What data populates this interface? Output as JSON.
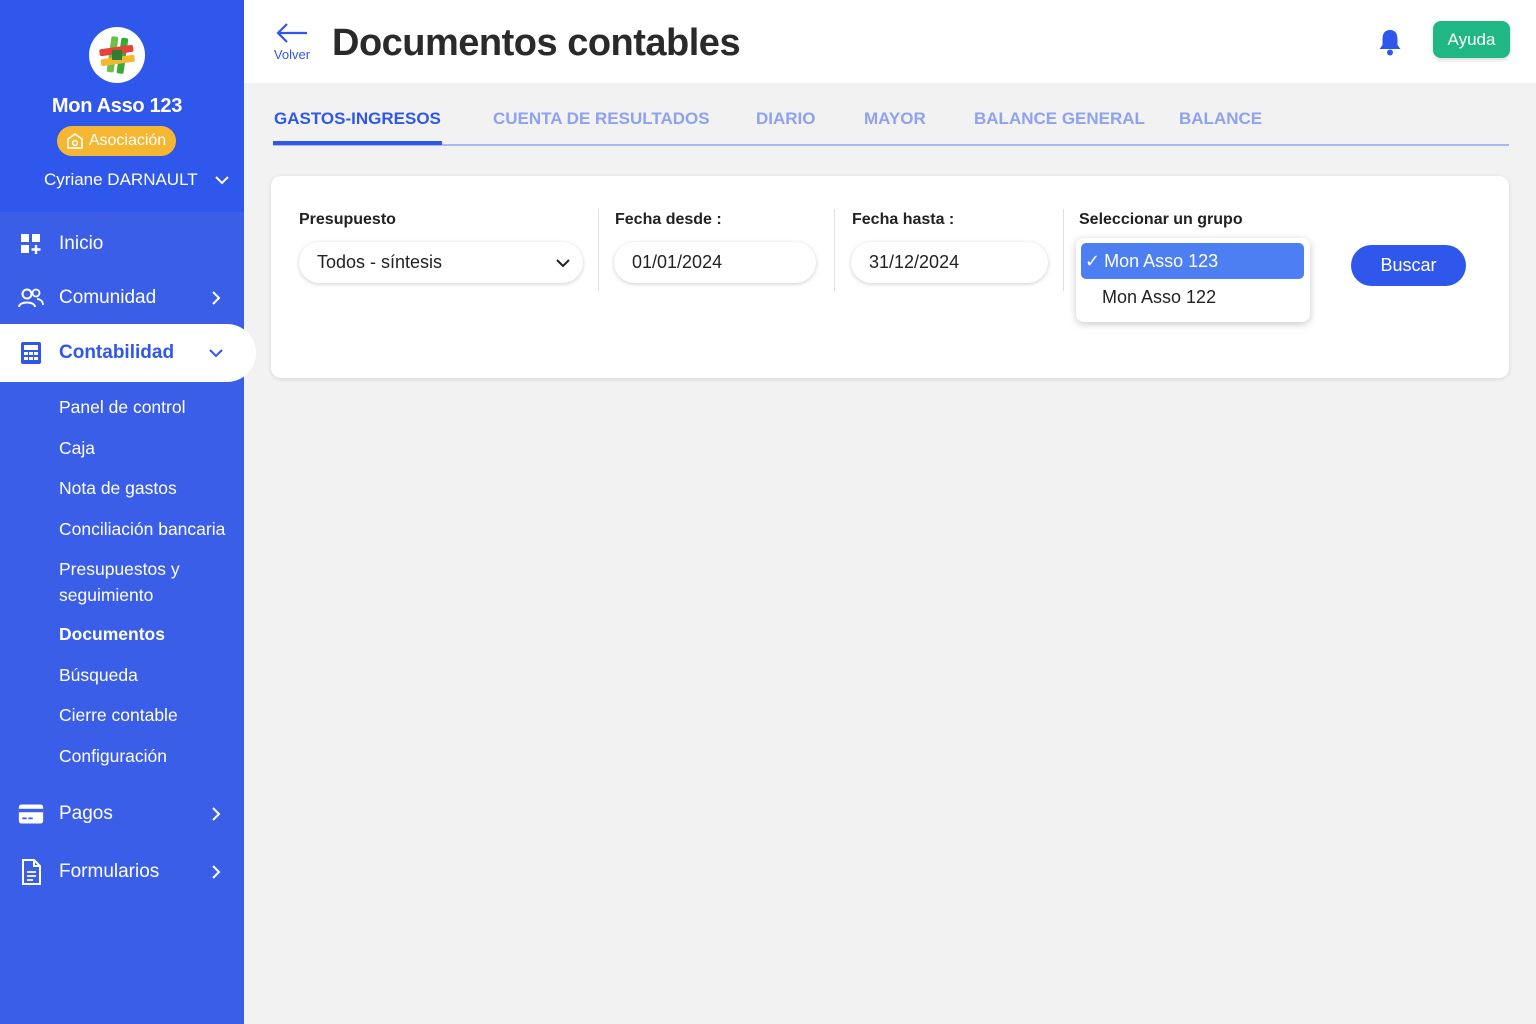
{
  "sidebar": {
    "org_name": "Mon Asso 123",
    "badge": "Asociación",
    "user": "Cyriane DARNAULT",
    "nav": {
      "inicio": "Inicio",
      "comunidad": "Comunidad",
      "contabilidad": "Contabilidad",
      "pagos": "Pagos",
      "formularios": "Formularios"
    },
    "sub_items": [
      "Panel de control",
      "Caja",
      "Nota de gastos",
      "Conciliación bancaria",
      "Presupuestos y",
      "seguimiento",
      "Documentos",
      "Búsqueda",
      "Cierre contable",
      "Configuración"
    ]
  },
  "header": {
    "back_label": "Volver",
    "title": "Documentos contables",
    "help_label": "Ayuda"
  },
  "tabs": [
    "GASTOS-INGRESOS",
    "CUENTA DE RESULTADOS",
    "DIARIO",
    "MAYOR",
    "BALANCE GENERAL",
    "BALANCE"
  ],
  "filters": {
    "presupuesto_label": "Presupuesto",
    "presupuesto_value": "Todos - síntesis",
    "fecha_desde_label": "Fecha desde :",
    "fecha_desde_value": "01/01/2024",
    "fecha_hasta_label": "Fecha hasta :",
    "fecha_hasta_value": "31/12/2024",
    "grupo_label": "Seleccionar un grupo",
    "grupo_options": [
      "Mon Asso 123",
      "Mon Asso 122"
    ],
    "selected_mark": "✓",
    "search_label": "Buscar"
  },
  "colors": {
    "primary": "#2f57ec",
    "sidebar": "#3a5ee8",
    "badge": "#f5b731",
    "help": "#1fb783"
  }
}
